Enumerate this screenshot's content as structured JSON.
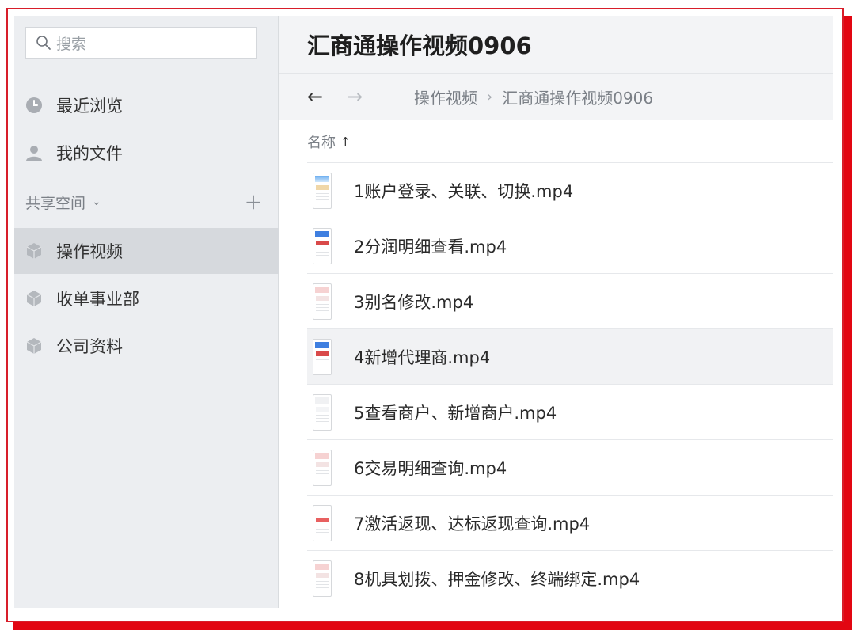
{
  "sidebar": {
    "search_placeholder": "搜索",
    "recent_label": "最近浏览",
    "my_files_label": "我的文件",
    "shared_section_label": "共享空间",
    "spaces": [
      {
        "label": "操作视频",
        "active": true
      },
      {
        "label": "收单事业部",
        "active": false
      },
      {
        "label": "公司资料",
        "active": false
      }
    ]
  },
  "main": {
    "title": "汇商通操作视频0906",
    "breadcrumb": [
      "操作视频",
      "汇商通操作视频0906"
    ],
    "column_name": "名称",
    "sort_arrow": "↑",
    "files": [
      {
        "name": "1账户登录、关联、切换.mp4",
        "thumb": "blue-top"
      },
      {
        "name": "2分润明细查看.mp4",
        "thumb": "blue-red"
      },
      {
        "name": "3别名修改.mp4",
        "thumb": "light-red"
      },
      {
        "name": "4新增代理商.mp4",
        "thumb": "blue-red"
      },
      {
        "name": "5查看商户、新增商户.mp4",
        "thumb": "plain"
      },
      {
        "name": "6交易明细查询.mp4",
        "thumb": "light-red"
      },
      {
        "name": "7激活返现、达标返现查询.mp4",
        "thumb": "red-mark"
      },
      {
        "name": "8机具划拨、押金修改、终端绑定.mp4",
        "thumb": "light-red"
      }
    ],
    "hover_index": 3
  },
  "colors": {
    "frame_red": "#e20612",
    "sidebar_bg": "#eceef1",
    "active_bg": "#d6d9dd",
    "header_bg": "#f3f4f6"
  }
}
